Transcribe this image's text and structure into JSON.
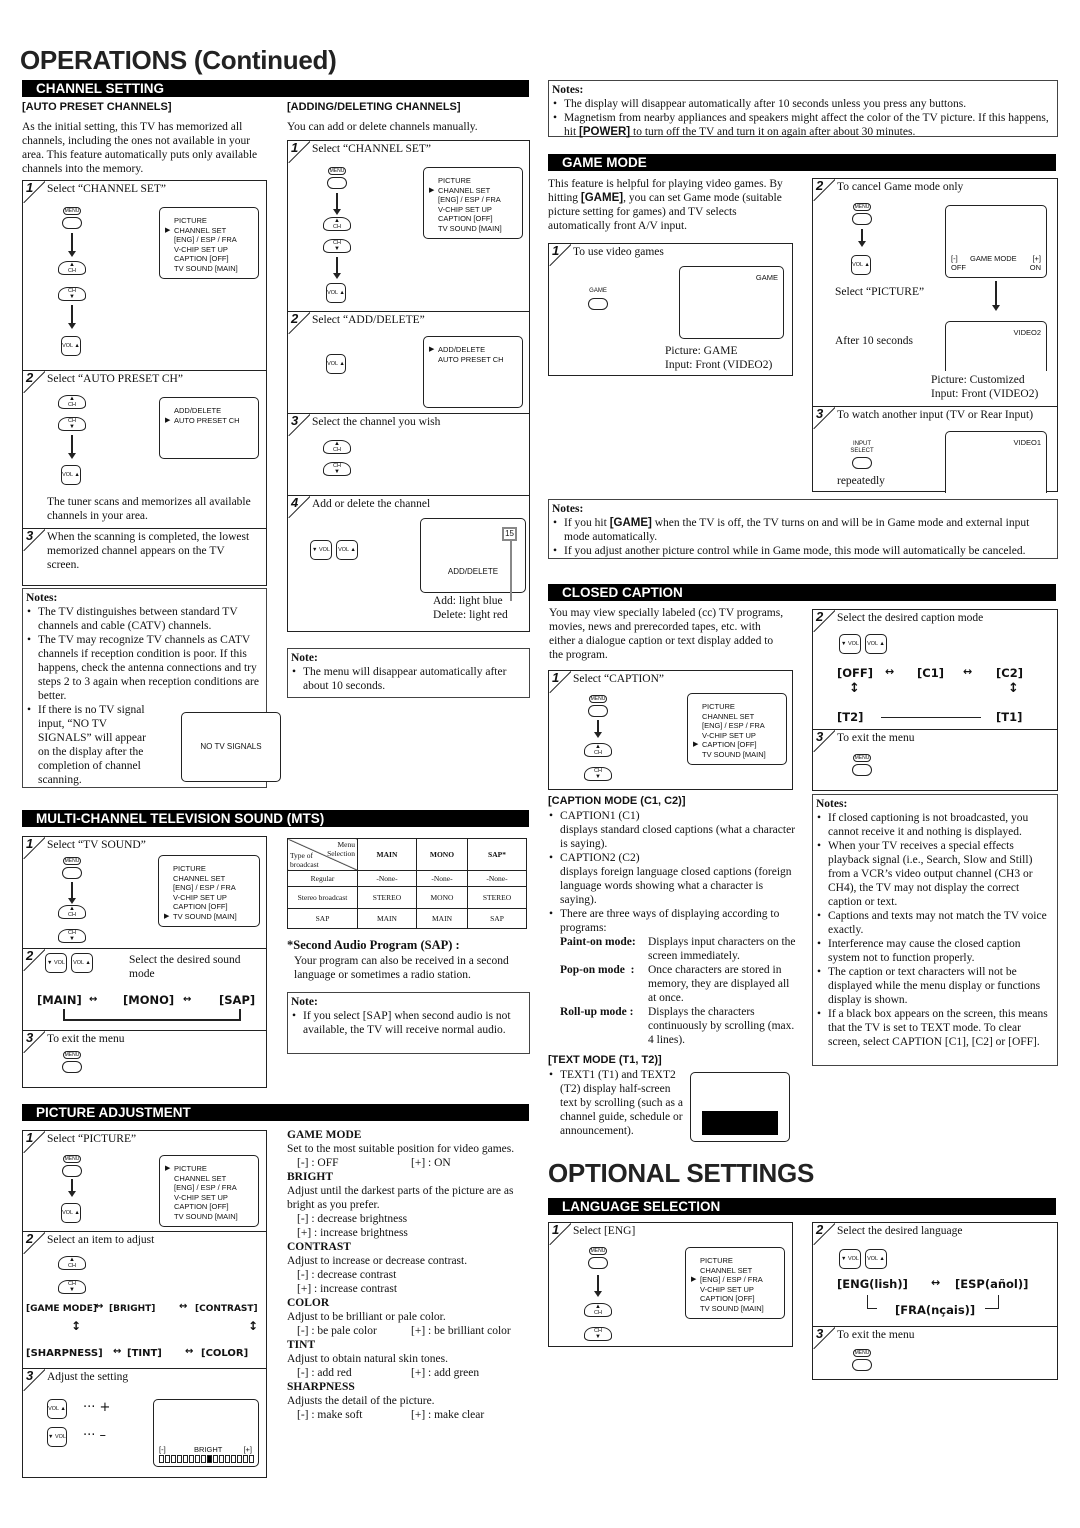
{
  "page_title": "OPERATIONS (Continued)",
  "channel_setting": {
    "bar": "CHANNEL SETTING",
    "auto": {
      "heading": "[AUTO PRESET CHANNELS]",
      "intro": "As the initial setting, this TV has memorized all channels, including the ones not available in your area. This feature automatically puts only available channels into the memory.",
      "steps": [
        {
          "num": "1",
          "text": "Select “CHANNEL SET”"
        },
        {
          "num": "2",
          "text": "Select “AUTO PRESET CH”"
        },
        {
          "num": "3",
          "text": "When the scanning is completed, the lowest memorized channel appears on the TV screen."
        }
      ],
      "scan_text": "The tuner scans and memorizes all available channels in your area.",
      "osd_step2": [
        "ADD/DELETE",
        "AUTO PRESET CH"
      ],
      "notes_title": "Notes:",
      "notes": [
        "The TV distinguishes between standard TV channels and cable (CATV) channels.",
        "The TV may recognize TV channels as CATV channels if reception condition is poor. If this happens, check the antenna connections and try steps 2 to 3 again when reception conditions are better.",
        "If there is no TV signal input, “NO TV SIGNALS” will appear on the display after the completion of channel scanning."
      ],
      "no_signal_osd": "NO TV SIGNALS"
    },
    "adding": {
      "heading": "[ADDING/DELETING CHANNELS]",
      "intro": "You can add or delete channels manually.",
      "steps": [
        {
          "num": "1",
          "text": "Select “CHANNEL SET”"
        },
        {
          "num": "2",
          "text": "Select “ADD/DELETE”"
        },
        {
          "num": "3",
          "text": "Select the channel you wish"
        },
        {
          "num": "4",
          "text": "Add or delete the channel"
        }
      ],
      "osd_step2": [
        "ADD/DELETE",
        "AUTO PRESET CH"
      ],
      "osd_step4_channel": "15",
      "osd_step4_label": "ADD/DELETE",
      "add_label": "Add: light blue",
      "delete_label": "Delete: light red",
      "note_title": "Note:",
      "note": "The menu will disappear automatically after about 10 seconds."
    }
  },
  "main_menu": [
    "PICTURE",
    "CHANNEL SET",
    "[ENG] / ESP / FRA",
    "V-CHIP SET UP",
    "CAPTION [OFF]",
    "TV SOUND [MAIN]"
  ],
  "buttons": {
    "menu": "MENU",
    "ch": "CH",
    "vol": "VOL",
    "game": "GAME",
    "input": "INPUT",
    "select": "SELECT"
  },
  "top_notes": {
    "title": "Notes:",
    "items": [
      "The display will disappear automatically after 10 seconds unless you press any buttons.",
      "Magnetism from nearby appliances and speakers might affect the color of the TV picture. If this happens, hit [POWER] to turn off the TV and turn it on again after about 30 minutes."
    ]
  },
  "game_mode": {
    "bar": "GAME MODE",
    "intro": "This feature is helpful for playing video games. By hitting [GAME], you can set Game mode (suitable picture setting for games) and TV selects automatically front A/V input.",
    "step1": {
      "num": "1",
      "text": "To use video games",
      "osd": "GAME",
      "picture": "Picture: GAME",
      "input": "Input: Front (VIDEO2)"
    },
    "step2": {
      "num": "2",
      "text": "To cancel Game mode only",
      "osd_minus": "[-]",
      "osd_label": "GAME MODE",
      "osd_plus": "[+]",
      "osd_off": "OFF",
      "osd_on": "ON",
      "select_picture": "Select “PICTURE”",
      "after": "After 10 seconds",
      "osd2": "VIDEO2",
      "picture": "Picture: Customized",
      "input": "Input: Front (VIDEO2)"
    },
    "step3": {
      "num": "3",
      "text": "To watch another input (TV or Rear Input)",
      "osd": "VIDEO1",
      "repeatedly": "repeatedly"
    },
    "notes_title": "Notes:",
    "notes": [
      "If you hit [GAME] when the TV is off, the TV turns on and will be in Game mode and external input mode automatically.",
      "If you adjust another picture control while in Game mode, this mode will automatically be canceled."
    ]
  },
  "closed_caption": {
    "bar": "CLOSED CAPTION",
    "intro": "You may view specially labeled (cc) TV programs, movies, news and prerecorded tapes, etc. with either a dialogue caption or text display added to the program.",
    "step1": {
      "num": "1",
      "text": "Select “CAPTION”"
    },
    "step2": {
      "num": "2",
      "text": "Select the desired caption mode",
      "flow": [
        "[OFF]",
        "[C1]",
        "[C2]",
        "[T1]",
        "[T2]"
      ]
    },
    "step3": {
      "num": "3",
      "text": "To exit the menu"
    },
    "caption_mode": {
      "heading": "[CAPTION MODE (C1, C2)]",
      "items": [
        {
          "title": "CAPTION1 (C1)",
          "desc": "displays standard closed captions (what a character is saying)."
        },
        {
          "title": "CAPTION2 (C2)",
          "desc": "displays foreign language closed captions (foreign language words showing what a character is saying)."
        },
        {
          "title": "There are three ways of displaying according to programs:",
          "desc": ""
        }
      ],
      "modes": [
        {
          "name": "Paint-on mode:",
          "desc": "Displays input characters on the screen immediately."
        },
        {
          "name": "Pop-on mode  :",
          "desc": "Once characters are stored in memory, they are displayed all at once."
        },
        {
          "name": "Roll-up mode :",
          "desc": "Displays the characters continuously by scrolling (max. 4 lines)."
        }
      ]
    },
    "text_mode": {
      "heading": "[TEXT MODE (T1, T2)]",
      "item": "TEXT1 (T1) and TEXT2 (T2) display half-screen text by scrolling (such as a channel guide, schedule or announcement)."
    },
    "notes_title": "Notes:",
    "notes": [
      "If closed captioning is not broadcasted, you cannot receive it and nothing is displayed.",
      "When your TV receives a special effects playback signal (i.e., Search, Slow and Still) from a VCR’s video output channel (CH3 or CH4), the TV may not display the correct caption or text.",
      "Captions and texts may not match the TV voice exactly.",
      "Interference may cause the closed caption system not to function properly.",
      "The caption or text characters will not be displayed while the menu display or functions display is shown.",
      "If a black box appears on the screen, this means that the TV is set to TEXT mode. To clear screen, select CAPTION [C1], [C2] or [OFF]."
    ]
  },
  "mts": {
    "bar": "MULTI-CHANNEL TELEVISION SOUND (MTS)",
    "step1": {
      "num": "1",
      "text": "Select “TV SOUND”"
    },
    "step2": {
      "num": "2",
      "text": "Select the desired sound mode",
      "flow": [
        "[MAIN]",
        "[MONO]",
        "[SAP]"
      ]
    },
    "step3": {
      "num": "3",
      "text": "To exit the menu"
    },
    "table": {
      "corner_top": "Menu Selection",
      "corner_bottom": "Type of broadcast",
      "headers": [
        "MAIN",
        "MONO",
        "SAP*"
      ],
      "rows": [
        {
          "type": "Regular",
          "values": [
            "-None-",
            "-None-",
            "-None-"
          ]
        },
        {
          "type": "Stereo broadcast",
          "values": [
            "STEREO",
            "MONO",
            "STEREO"
          ]
        },
        {
          "type": "SAP",
          "values": [
            "MAIN",
            "MAIN",
            "SAP"
          ]
        }
      ]
    },
    "sap_title": "*Second Audio Program (SAP) :",
    "sap_text": "Your program can also be received in a second language or sometimes a radio station.",
    "note_title": "Note:",
    "note": "If you select [SAP] when second audio is not available, the TV will receive normal audio."
  },
  "picture_adjustment": {
    "bar": "PICTURE ADJUSTMENT",
    "step1": {
      "num": "1",
      "text": "Select “PICTURE”"
    },
    "step2": {
      "num": "2",
      "text": "Select an item to adjust",
      "row1": [
        "[GAME MODE]",
        "[BRIGHT]",
        "[CONTRAST]"
      ],
      "row2": [
        "[SHARPNESS]",
        "[TINT]",
        "[COLOR]"
      ]
    },
    "step3": {
      "num": "3",
      "text": "Adjust the setting",
      "plus": "··· +",
      "minus": "··· –",
      "osd_minus": "[-]",
      "osd_label": "BRIGHT",
      "osd_plus": "[+]",
      "level": 0.5
    },
    "items": [
      {
        "name": "GAME MODE",
        "desc": "Set to the most suitable position for video games.",
        "minus": "[-] : OFF",
        "plus": "[+] : ON",
        "inline": true
      },
      {
        "name": "BRIGHT",
        "desc": "Adjust until the darkest parts of the picture are as bright as you prefer.",
        "minus": "[-] : decrease brightness",
        "plus": "[+] : increase brightness",
        "inline": false
      },
      {
        "name": "CONTRAST",
        "desc": "Adjust to increase or decrease contrast.",
        "minus": "[-] : decrease contrast",
        "plus": "[+] : increase contrast",
        "inline": false
      },
      {
        "name": "COLOR",
        "desc": "Adjust to be brilliant or pale color.",
        "minus": "[-] : be pale color",
        "plus": "[+] : be brilliant color",
        "inline": true
      },
      {
        "name": "TINT",
        "desc": "Adjust to obtain natural skin tones.",
        "minus": "[-] : add red",
        "plus": "[+] : add green",
        "inline": true
      },
      {
        "name": "SHARPNESS",
        "desc": "Adjusts the detail of the picture.",
        "minus": "[-] : make soft",
        "plus": "[+] : make clear",
        "inline": true
      }
    ]
  },
  "optional_title": "OPTIONAL SETTINGS",
  "language": {
    "bar": "LANGUAGE SELECTION",
    "step1": {
      "num": "1",
      "text": "Select [ENG]"
    },
    "step2": {
      "num": "2",
      "text": "Select the desired language",
      "eng": "[ENG(lish)]",
      "esp": "[ESP(añol)]",
      "fra": "[FRA(nçais)]"
    },
    "step3": {
      "num": "3",
      "text": "To exit the menu"
    }
  }
}
